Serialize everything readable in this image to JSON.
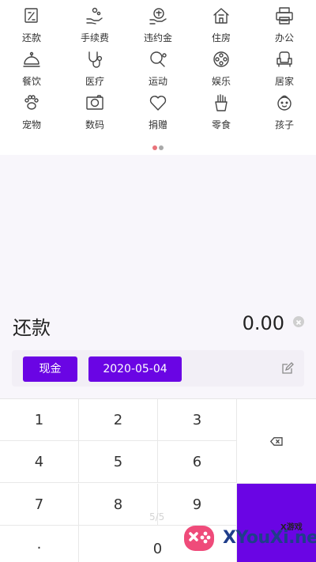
{
  "categories": [
    {
      "label": "还款",
      "icon": "repay-icon"
    },
    {
      "label": "手续费",
      "icon": "fee-icon"
    },
    {
      "label": "违约金",
      "icon": "penalty-icon"
    },
    {
      "label": "住房",
      "icon": "house-icon"
    },
    {
      "label": "办公",
      "icon": "printer-icon"
    },
    {
      "label": "餐饮",
      "icon": "dining-cloche-icon"
    },
    {
      "label": "医疗",
      "icon": "stethoscope-icon"
    },
    {
      "label": "运动",
      "icon": "ping-pong-icon"
    },
    {
      "label": "娱乐",
      "icon": "film-reel-icon"
    },
    {
      "label": "居家",
      "icon": "armchair-icon"
    },
    {
      "label": "宠物",
      "icon": "paw-icon"
    },
    {
      "label": "数码",
      "icon": "camera-icon"
    },
    {
      "label": "捐赠",
      "icon": "heart-icon"
    },
    {
      "label": "零食",
      "icon": "fries-icon"
    },
    {
      "label": "孩子",
      "icon": "child-face-icon"
    }
  ],
  "pagination_dots": {
    "count": 2,
    "active_index": 0
  },
  "entry": {
    "category": "还款",
    "amount": "0.00",
    "payment_method": "现金",
    "date": "2020-05-04"
  },
  "keypad": {
    "keys": [
      "1",
      "2",
      "3",
      "4",
      "5",
      "6",
      "7",
      "8",
      "9",
      ".",
      "0"
    ]
  },
  "overlay_pager": "5/5",
  "watermark": {
    "text": "XYouXi.net",
    "sub": "X游戏"
  },
  "colors": {
    "accent": "#6a05e4",
    "dot_active": "#e9737a",
    "dot_inactive": "#a9a9a9",
    "panel": "#f8f6fb"
  }
}
